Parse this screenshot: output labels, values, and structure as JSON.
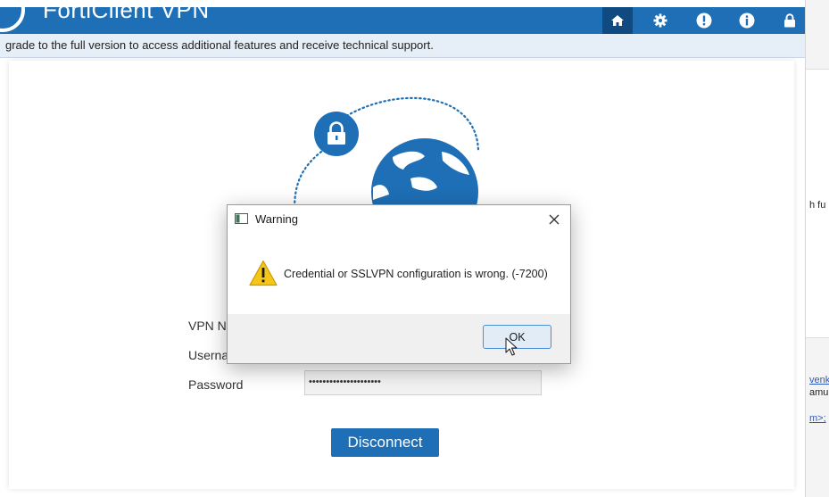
{
  "header": {
    "app_title": "FortiClient VPN",
    "icons": [
      "home-icon",
      "gear-icon",
      "alert-icon",
      "info-icon",
      "lock-icon"
    ],
    "accent_color": "#1e6fb5"
  },
  "notice": {
    "text": "grade to the full version to access additional features and receive technical support."
  },
  "form": {
    "vpn_name_label": "VPN N",
    "username_label": "Userna",
    "password_label": "Password",
    "password_value": "•••••••••••••••••••••"
  },
  "disconnect_label": "Disconnect",
  "dialog": {
    "title": "Warning",
    "message": "Credential or SSLVPN configuration is wrong. (-7200)",
    "ok_label": "OK"
  },
  "background_window": {
    "text1": "h fu",
    "text2": "venka",
    "text3": "amun",
    "text4": "m>;"
  }
}
